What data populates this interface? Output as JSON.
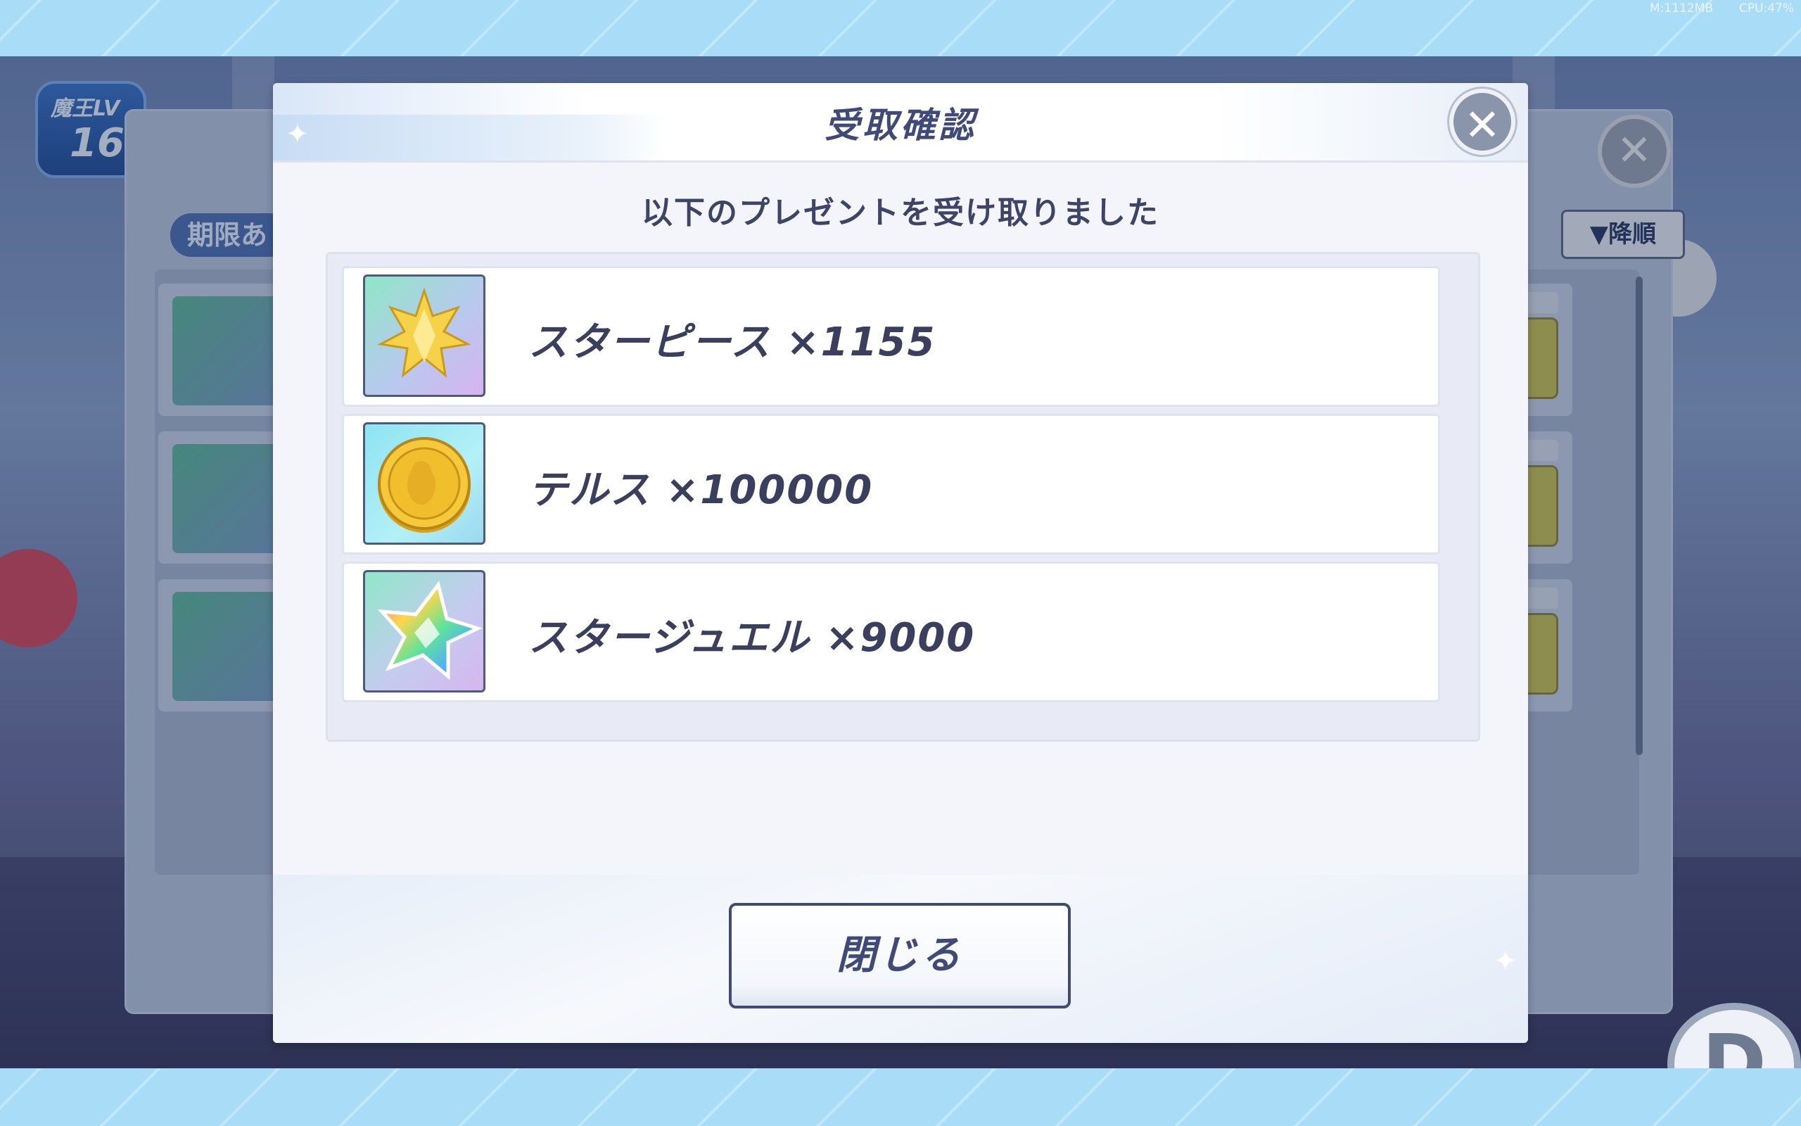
{
  "system_overlay": {
    "memory": "M:1112MB",
    "cpu": "CPU:47%"
  },
  "background": {
    "level_badge": {
      "label": "魔王LV",
      "value": "16"
    },
    "sort_button": "▼降順",
    "filter_tag": "期限あ"
  },
  "dialog": {
    "title": "受取確認",
    "subtitle": "以下のプレゼントを受け取りました",
    "items": [
      {
        "name": "スターピース",
        "quantity": "×1155",
        "icon": "star-piece-icon"
      },
      {
        "name": "テルス",
        "quantity": "×100000",
        "icon": "gold-coin-icon"
      },
      {
        "name": "スタージュエル",
        "quantity": "×9000",
        "icon": "rainbow-star-jewel-icon"
      }
    ],
    "close_button": "閉じる",
    "close_icon": "close-icon"
  },
  "colors": {
    "title_text": "#3f4a78",
    "item_text": "#3a3f5e",
    "band": "#a9dcf7"
  }
}
